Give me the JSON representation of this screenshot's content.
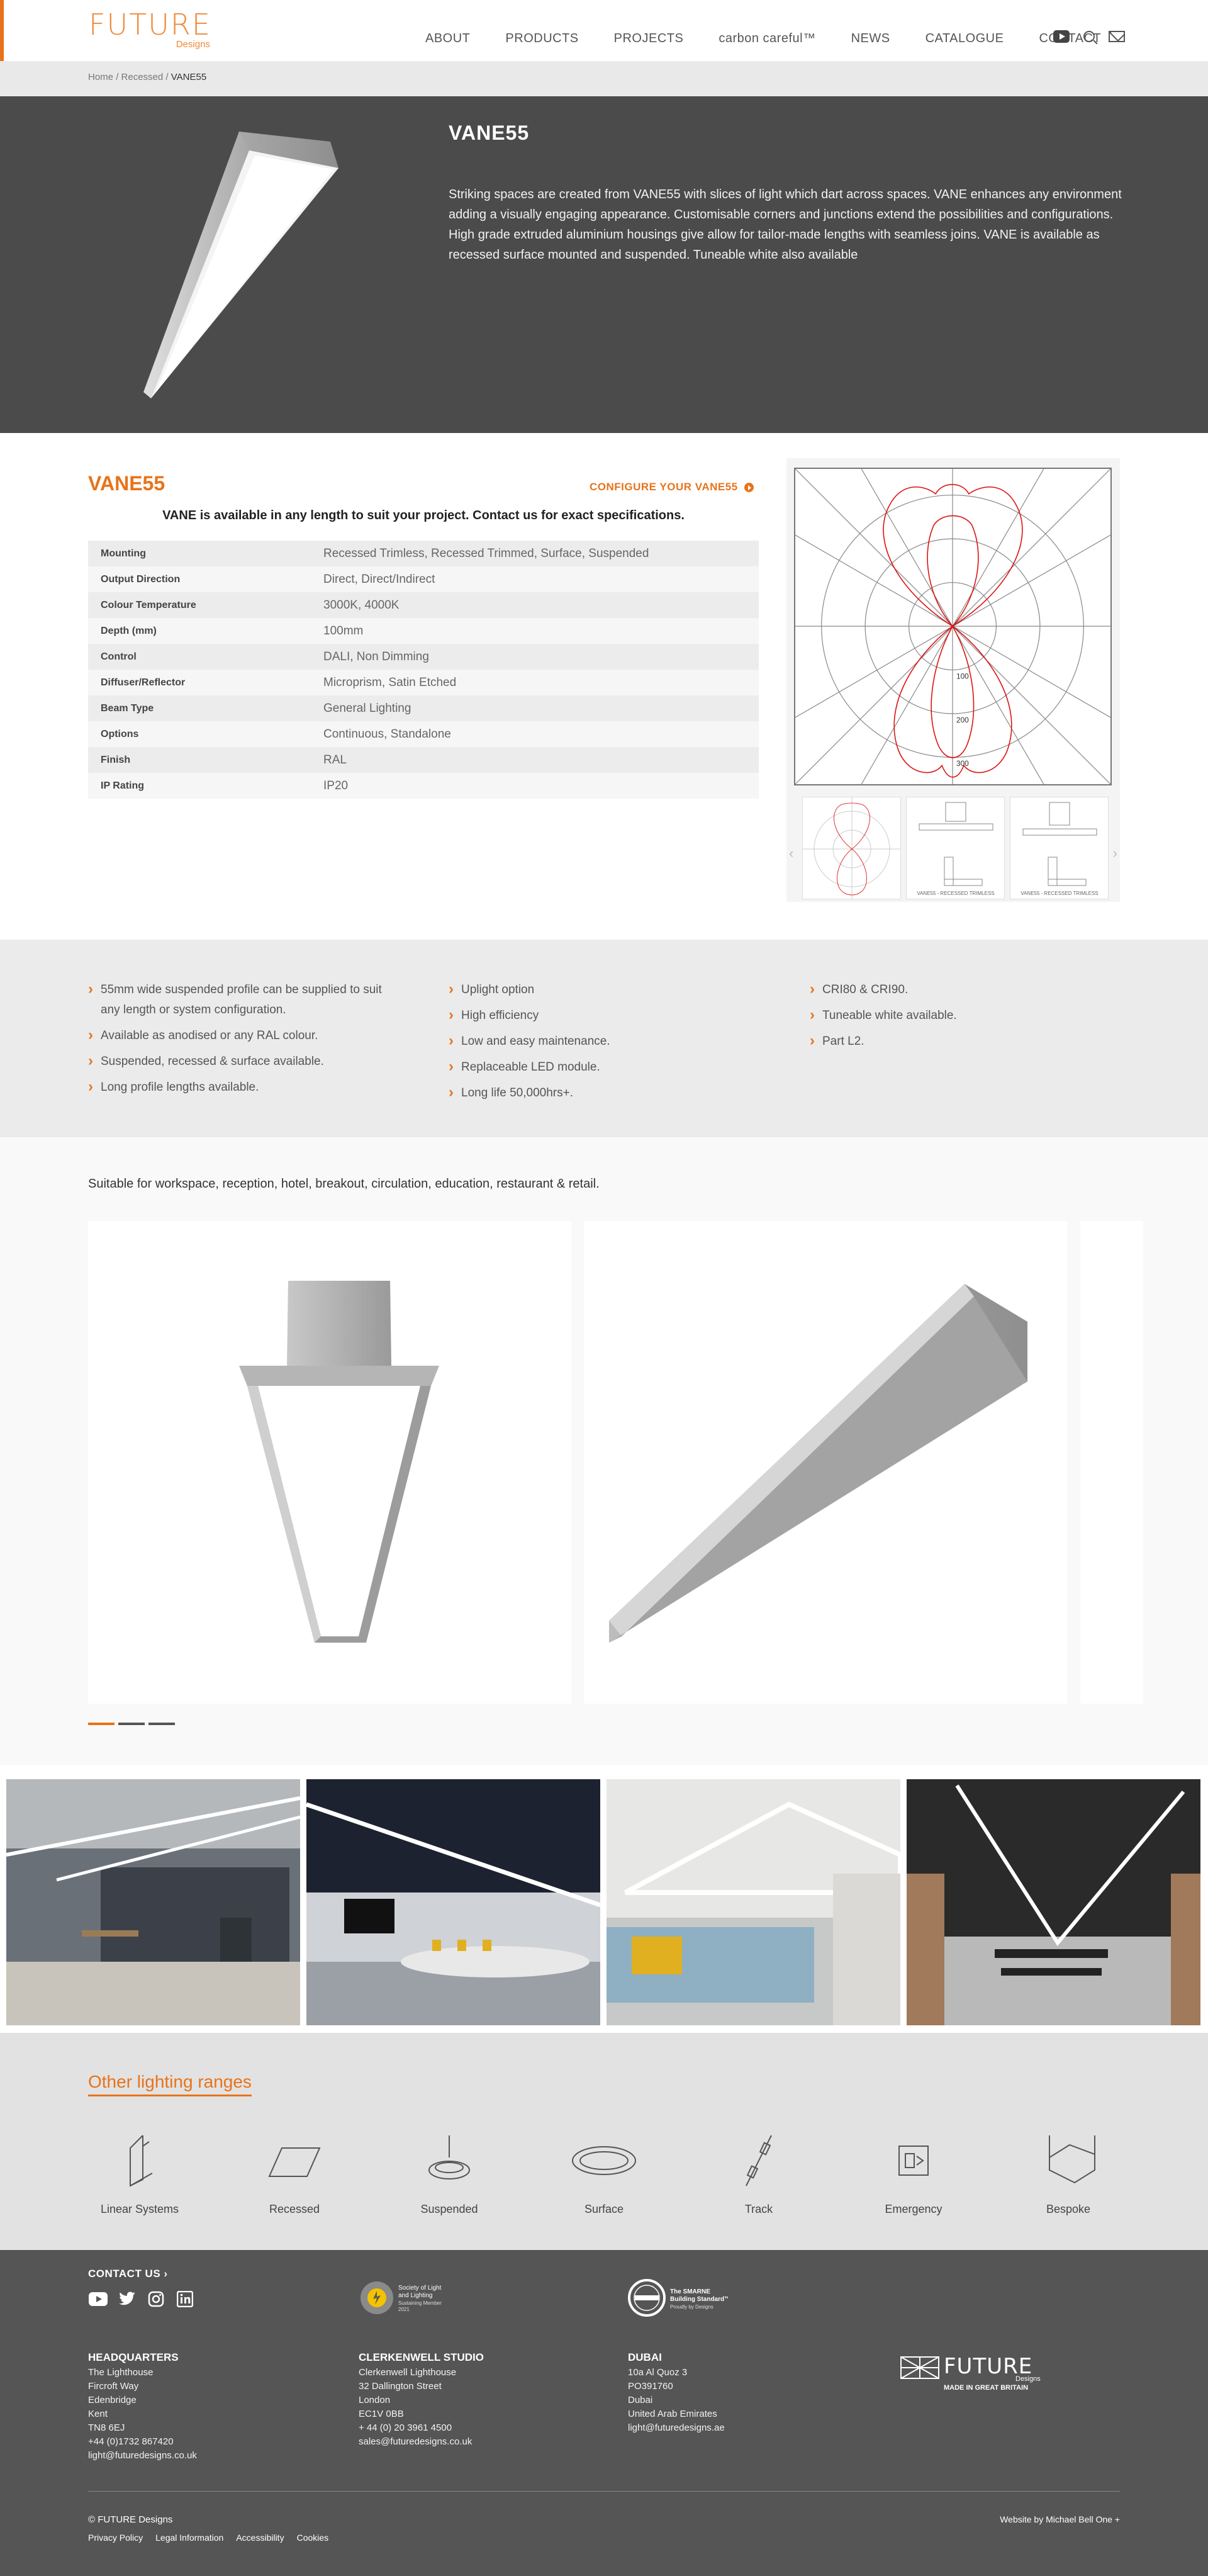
{
  "header": {
    "logo_main": "FUTURE",
    "logo_sub": "Designs",
    "nav": [
      "ABOUT",
      "PRODUCTS",
      "PROJECTS",
      "carbon careful™",
      "NEWS",
      "CATALOGUE",
      "CONTACT"
    ],
    "icons": [
      "youtube-icon",
      "search-icon",
      "mail-icon"
    ]
  },
  "breadcrumb": {
    "home": "Home",
    "section": "Recessed",
    "current": "VANE55",
    "sep": "/"
  },
  "hero": {
    "title": "VANE55",
    "description": "Striking spaces are created from VANE55 with slices of light which dart across spaces. VANE enhances any environment adding a visually engaging appearance. Customisable corners and junctions extend the possibilities and configurations. High grade extruded aluminium housings give allow for tailor-made lengths with seamless joins. VANE is available as recessed surface mounted and suspended. Tuneable white also available"
  },
  "spec": {
    "title": "VANE55",
    "configure_label": "CONFIGURE YOUR VANE55",
    "note": "VANE is available in any length to suit your project. Contact us for exact specifications.",
    "rows": [
      {
        "key": "Mounting",
        "value": "Recessed Trimless, Recessed Trimmed, Surface, Suspended"
      },
      {
        "key": "Output Direction",
        "value": "Direct, Direct/Indirect"
      },
      {
        "key": "Colour Temperature",
        "value": "3000K, 4000K"
      },
      {
        "key": "Depth (mm)",
        "value": "100mm"
      },
      {
        "key": "Control",
        "value": "DALI, Non Dimming"
      },
      {
        "key": "Diffuser/Reflector",
        "value": "Microprism, Satin Etched"
      },
      {
        "key": "Beam Type",
        "value": "General Lighting"
      },
      {
        "key": "Options",
        "value": "Continuous, Standalone"
      },
      {
        "key": "Finish",
        "value": "RAL"
      },
      {
        "key": "IP Rating",
        "value": "IP20"
      }
    ],
    "polar_labels": [
      "100",
      "200",
      "300"
    ],
    "thumb_captions": [
      "",
      "VANE55 - RECESSED TRIMLESS",
      "VANE55 - RECESSED TRIMLESS"
    ]
  },
  "features": {
    "col1": [
      "55mm wide suspended profile can be supplied to suit any length or system configuration.",
      "Available as anodised or any RAL colour.",
      "Suspended, recessed & surface available.",
      "Long profile lengths available."
    ],
    "col2": [
      "Uplight option",
      "High efficiency",
      "Low and easy maintenance.",
      "Replaceable LED module.",
      "Long life 50,000hrs+."
    ],
    "col3": [
      "CRI80 & CRI90.",
      "Tuneable white available.",
      "Part L2."
    ]
  },
  "products": {
    "suitable": "Suitable for workspace, reception, hotel, breakout, circulation, education, restaurant & retail."
  },
  "ranges": {
    "title": "Other lighting ranges",
    "items": [
      {
        "label": "Linear Systems",
        "icon": "linear-systems-icon"
      },
      {
        "label": "Recessed",
        "icon": "recessed-icon"
      },
      {
        "label": "Suspended",
        "icon": "suspended-icon"
      },
      {
        "label": "Surface",
        "icon": "surface-icon"
      },
      {
        "label": "Track",
        "icon": "track-icon"
      },
      {
        "label": "Emergency",
        "icon": "emergency-icon"
      },
      {
        "label": "Bespoke",
        "icon": "bespoke-icon"
      }
    ]
  },
  "footer": {
    "contact_us": "CONTACT US",
    "badge1": [
      "Society of Light",
      "and Lighting",
      "Sustaining Member",
      "2021"
    ],
    "badge2": [
      "The SMARNE",
      "Building Standard™",
      "Proudly by Designs"
    ],
    "hq": {
      "title": "HEADQUARTERS",
      "lines": [
        "The Lighthouse",
        "Fircroft Way",
        "Edenbridge",
        "Kent",
        "TN8 6EJ",
        "+44 (0)1732 867420",
        "light@futuredesigns.co.uk"
      ]
    },
    "clerkenwell": {
      "title": "CLERKENWELL STUDIO",
      "lines": [
        "Clerkenwell Lighthouse",
        "32 Dallington Street",
        "London",
        "EC1V 0BB",
        "+ 44 (0) 20 3961 4500",
        "sales@futuredesigns.co.uk"
      ]
    },
    "dubai": {
      "title": "DUBAI",
      "lines": [
        "10a Al Quoz 3",
        "PO391760",
        "Dubai",
        "United Arab Emirates",
        "light@futuredesigns.ae"
      ]
    },
    "logo_main": "FUTURE",
    "logo_sub": "Designs",
    "logo_tag": "MADE IN GREAT BRITAIN",
    "copyright": "© FUTURE Designs",
    "legal": [
      "Privacy Policy",
      "Legal Information",
      "Accessibility",
      "Cookies"
    ],
    "credit": "Website by Michael Bell One +"
  },
  "colors": {
    "accent": "#e8731a",
    "hero_bg": "#4b4b4b",
    "footer_bg": "#555555"
  }
}
